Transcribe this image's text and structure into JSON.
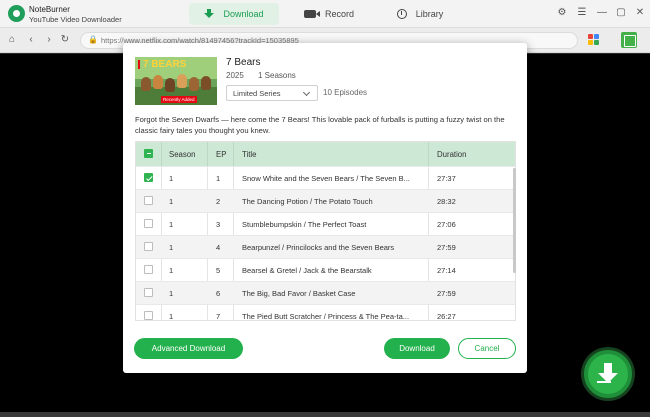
{
  "app": {
    "name": "NoteBurner",
    "subtitle": "YouTube Video Downloader"
  },
  "tabs": [
    {
      "label": "Download",
      "active": true,
      "icon": "download-icon"
    },
    {
      "label": "Record",
      "active": false,
      "icon": "video-camera-icon"
    },
    {
      "label": "Library",
      "active": false,
      "icon": "clock-icon"
    }
  ],
  "window_controls": [
    "gear-icon",
    "menu-icon",
    "minimize-icon",
    "maximize-icon",
    "close-icon"
  ],
  "nav": {
    "url": "https://www.netflix.com/watch/81497456?trackId=15035895"
  },
  "colors": {
    "accent": "#23b14d",
    "header_row": "#cde8d4",
    "netflix_red": "#e50914"
  },
  "dialog": {
    "poster": {
      "title": "7 BEARS",
      "badge": "Recently Added"
    },
    "title": "7 Bears",
    "year": "2025",
    "seasons": "1 Seasons",
    "season_select": "Limited Series",
    "episodes": "10 Episodes",
    "description": "Forgot the Seven Dwarfs — here come the 7 Bears! This lovable pack of furballs is putting a fuzzy twist on the classic fairy tales you thought you knew.",
    "table": {
      "headers": {
        "season": "Season",
        "ep": "EP",
        "title": "Title",
        "duration": "Duration"
      },
      "rows": [
        {
          "season": "1",
          "ep": "1",
          "title": "Snow White and the Seven Bears / The Seven B...",
          "duration": "27:37",
          "checked": true
        },
        {
          "season": "1",
          "ep": "2",
          "title": "The Dancing Potion / The Potato Touch",
          "duration": "28:32",
          "checked": false
        },
        {
          "season": "1",
          "ep": "3",
          "title": "Stumblebumpskin / The Perfect Toast",
          "duration": "27:06",
          "checked": false
        },
        {
          "season": "1",
          "ep": "4",
          "title": "Bearpunzel / Princilocks and the Seven Bears",
          "duration": "27:59",
          "checked": false
        },
        {
          "season": "1",
          "ep": "5",
          "title": "Bearsel & Gretel / Jack & the Bearstalk",
          "duration": "27:14",
          "checked": false
        },
        {
          "season": "1",
          "ep": "6",
          "title": "The Big, Bad Favor / Basket Case",
          "duration": "27:59",
          "checked": false
        },
        {
          "season": "1",
          "ep": "7",
          "title": "The Pied Butt Scratcher / Princess & The Pea-ta...",
          "duration": "26:27",
          "checked": false
        }
      ]
    },
    "buttons": {
      "advanced": "Advanced Download",
      "download": "Download",
      "cancel": "Cancel"
    }
  }
}
